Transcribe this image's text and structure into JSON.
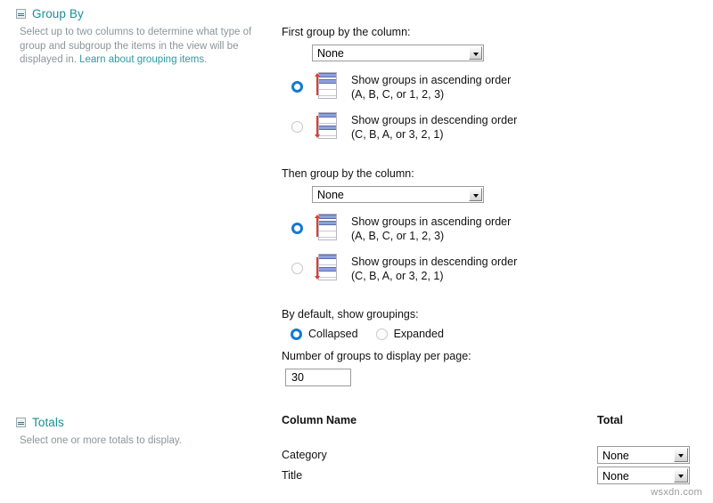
{
  "group_by": {
    "title": "Group By",
    "collapse_icon": "collapse-box-icon",
    "description_part1": "Select up to two columns to determine what type of group and subgroup the items in the view will be displayed in. ",
    "link_text": "Learn about grouping items",
    "description_part2": ".",
    "first_group_label": "First group by the column:",
    "first_group_value": "None",
    "then_group_label": "Then group by the column:",
    "then_group_value": "None",
    "first_order": {
      "ascending": {
        "line1": "Show groups in ascending order",
        "line2": "(A, B, C, or 1, 2, 3)",
        "selected": true,
        "icon": "sort-ascending-icon"
      },
      "descending": {
        "line1": "Show groups in descending order",
        "line2": "(C, B, A, or 3, 2, 1)",
        "selected": false,
        "icon": "sort-descending-icon"
      }
    },
    "then_order": {
      "ascending": {
        "line1": "Show groups in ascending order",
        "line2": "(A, B, C, or 1, 2, 3)",
        "selected": true,
        "icon": "sort-ascending-icon"
      },
      "descending": {
        "line1": "Show groups in descending order",
        "line2": "(C, B, A, or 3, 2, 1)",
        "selected": false,
        "icon": "sort-descending-icon"
      }
    },
    "default_show_label": "By default, show groupings:",
    "collapsed_label": "Collapsed",
    "expanded_label": "Expanded",
    "collapsed_selected": true,
    "expanded_selected": false,
    "groups_per_page_label": "Number of groups to display per page:",
    "groups_per_page_value": "30"
  },
  "totals": {
    "title": "Totals",
    "collapse_icon": "collapse-box-icon",
    "description": "Select one or more totals to display.",
    "headers": {
      "column_name": "Column Name",
      "total": "Total"
    },
    "rows": [
      {
        "column_name": "Category",
        "total": "None"
      },
      {
        "column_name": "Title",
        "total": "None"
      }
    ]
  },
  "watermark": "wsxdn.com",
  "colors": {
    "section_title": "#1a8f96",
    "link": "#2e9aa0",
    "description": "#8d9599",
    "radio_selected": "#1279d4",
    "sort_arrow": "#e23b2e",
    "sort_row": "#8ea0d8"
  }
}
